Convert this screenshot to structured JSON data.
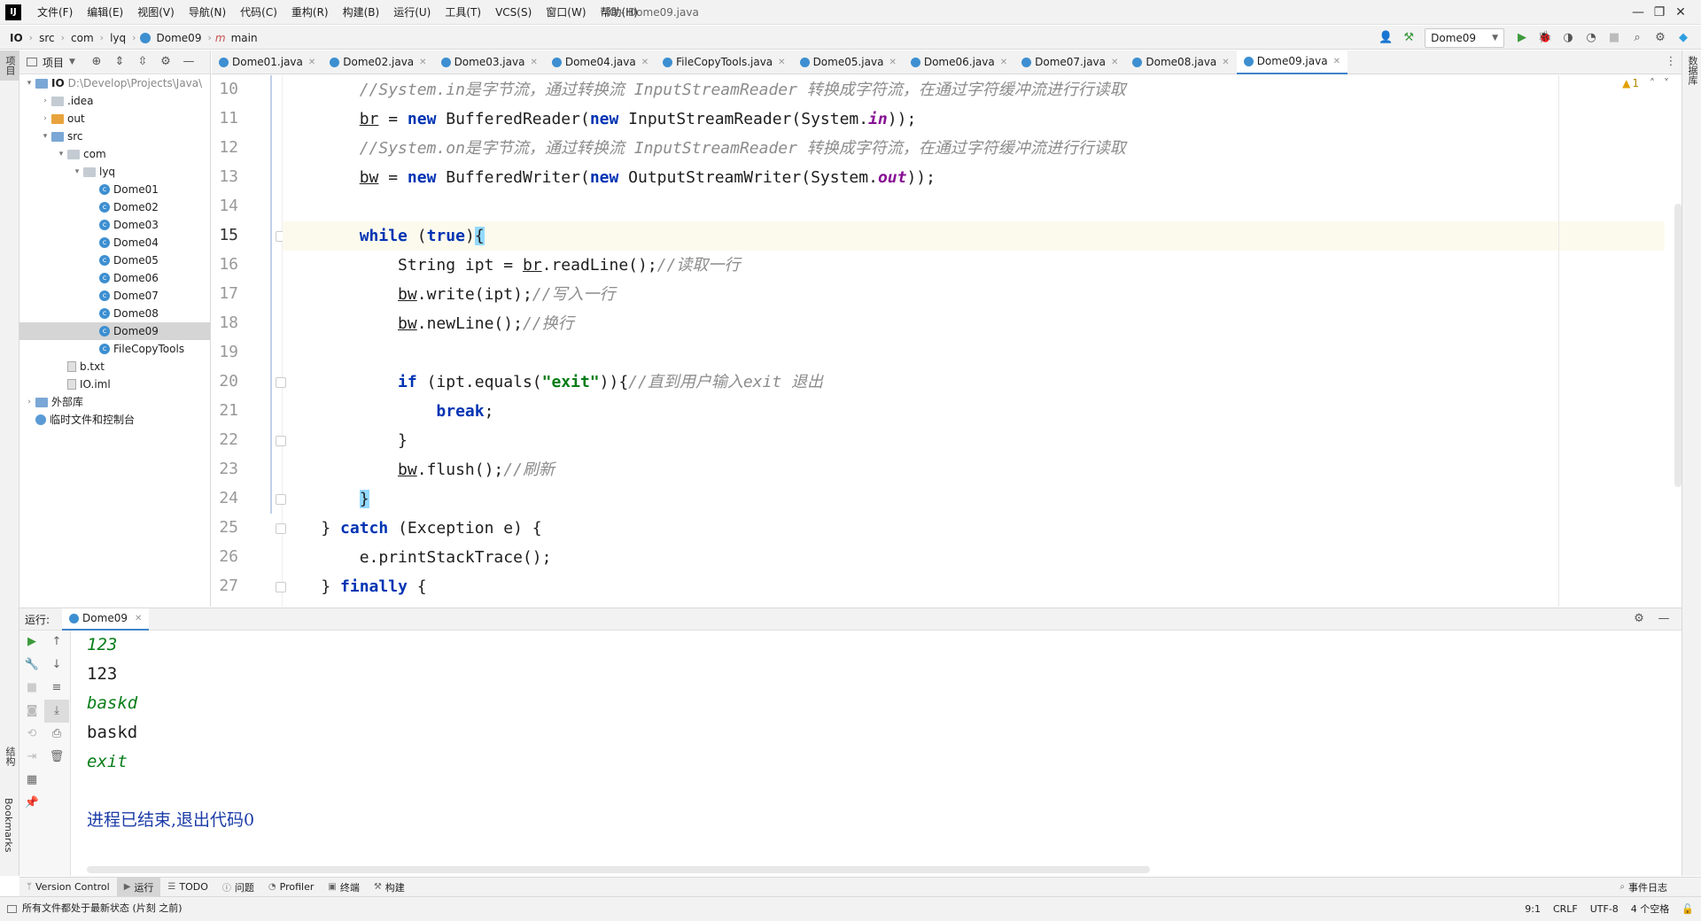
{
  "menubar": {
    "logo": "IJ",
    "items": [
      "文件(F)",
      "编辑(E)",
      "视图(V)",
      "导航(N)",
      "代码(C)",
      "重构(R)",
      "构建(B)",
      "运行(U)",
      "工具(T)",
      "VCS(S)",
      "窗口(W)",
      "帮助(H)"
    ],
    "title": "IO - Dome09.java",
    "controls": [
      "—",
      "❐",
      "✕"
    ]
  },
  "breadcrumb": {
    "items": [
      "IO",
      "src",
      "com",
      "lyq",
      "Dome09",
      "main"
    ]
  },
  "toolbar": {
    "run_config": "Dome09"
  },
  "left_stripe": {
    "project": "项目",
    "structure": "结构",
    "bookmarks": "Bookmarks"
  },
  "right_stripe": {
    "database": "数据库"
  },
  "project_panel": {
    "header": "项目",
    "tree": [
      {
        "label": "IO",
        "extra": "D:\\Develop\\Projects\\Java\\",
        "depth": 0,
        "arrow": "▾",
        "icon": "folder-blue"
      },
      {
        "label": ".idea",
        "depth": 1,
        "arrow": "›",
        "icon": "folder"
      },
      {
        "label": "out",
        "depth": 1,
        "arrow": "›",
        "icon": "folder-orange"
      },
      {
        "label": "src",
        "depth": 1,
        "arrow": "▾",
        "icon": "folder-blue"
      },
      {
        "label": "com",
        "depth": 2,
        "arrow": "▾",
        "icon": "folder"
      },
      {
        "label": "lyq",
        "depth": 3,
        "arrow": "▾",
        "icon": "folder"
      },
      {
        "label": "Dome01",
        "depth": 4,
        "arrow": "",
        "icon": "class"
      },
      {
        "label": "Dome02",
        "depth": 4,
        "arrow": "",
        "icon": "class"
      },
      {
        "label": "Dome03",
        "depth": 4,
        "arrow": "",
        "icon": "class"
      },
      {
        "label": "Dome04",
        "depth": 4,
        "arrow": "",
        "icon": "class"
      },
      {
        "label": "Dome05",
        "depth": 4,
        "arrow": "",
        "icon": "class"
      },
      {
        "label": "Dome06",
        "depth": 4,
        "arrow": "",
        "icon": "class"
      },
      {
        "label": "Dome07",
        "depth": 4,
        "arrow": "",
        "icon": "class"
      },
      {
        "label": "Dome08",
        "depth": 4,
        "arrow": "",
        "icon": "class"
      },
      {
        "label": "Dome09",
        "depth": 4,
        "arrow": "",
        "icon": "class",
        "selected": true
      },
      {
        "label": "FileCopyTools",
        "depth": 4,
        "arrow": "",
        "icon": "class"
      },
      {
        "label": "b.txt",
        "depth": 2,
        "arrow": "",
        "icon": "file"
      },
      {
        "label": "IO.iml",
        "depth": 2,
        "arrow": "",
        "icon": "file"
      },
      {
        "label": "外部库",
        "depth": 0,
        "arrow": "›",
        "icon": "library"
      },
      {
        "label": "临时文件和控制台",
        "depth": 0,
        "arrow": "",
        "icon": "scratch"
      }
    ]
  },
  "tabs": [
    "Dome01.java",
    "Dome02.java",
    "Dome03.java",
    "Dome04.java",
    "FileCopyTools.java",
    "Dome05.java",
    "Dome06.java",
    "Dome07.java",
    "Dome08.java",
    "Dome09.java"
  ],
  "active_tab": "Dome09.java",
  "editor": {
    "warning_count": "1",
    "line_numbers": [
      "10",
      "11",
      "12",
      "13",
      "14",
      "15",
      "16",
      "17",
      "18",
      "19",
      "20",
      "21",
      "22",
      "23",
      "24",
      "25",
      "26",
      "27"
    ],
    "current_line": "15",
    "code": {
      "l10_comment": "//System.in是字节流，通过转换流 InputStreamReader 转换成字符流，在通过字符缓冲流进行行读取",
      "l11_a": "br",
      "l11_b": " = ",
      "l11_new1": "new",
      "l11_c": " BufferedReader(",
      "l11_new2": "new",
      "l11_d": " InputStreamReader(System.",
      "l11_field": "in",
      "l11_e": "));",
      "l12_comment": "//System.on是字节流，通过转换流 InputStreamReader 转换成字符流，在通过字符缓冲流进行行读取",
      "l13_a": "bw",
      "l13_b": " = ",
      "l13_new1": "new",
      "l13_c": " BufferedWriter(",
      "l13_new2": "new",
      "l13_d": " OutputStreamWriter(System.",
      "l13_field": "out",
      "l13_e": "));",
      "l15_while": "while",
      "l15_b": " (",
      "l15_true": "true",
      "l15_c": ")",
      "l15_brace": "{",
      "l16_a": "String ipt = ",
      "l16_br": "br",
      "l16_b": ".readLine();",
      "l16_comment": "//读取一行",
      "l17_bw": "bw",
      "l17_a": ".write(ipt);",
      "l17_comment": "//写入一行",
      "l18_bw": "bw",
      "l18_a": ".newLine();",
      "l18_comment": "//换行",
      "l20_if": "if",
      "l20_a": " (ipt.equals(",
      "l20_str": "\"exit\"",
      "l20_b": ")){",
      "l20_comment": "//直到用户输入exit 退出",
      "l21_break": "break",
      "l21_a": ";",
      "l22": "}",
      "l23_bw": "bw",
      "l23_a": ".flush();",
      "l23_comment": "//刷新",
      "l24_brace": "}",
      "l25_a": "} ",
      "l25_catch": "catch",
      "l25_b": " (Exception e) {",
      "l26": "e.printStackTrace();",
      "l27_a": "} ",
      "l27_finally": "finally",
      "l27_b": " {"
    }
  },
  "run_panel": {
    "label": "运行:",
    "tab": "Dome09",
    "console": [
      {
        "text": "123",
        "kind": "input"
      },
      {
        "text": "123",
        "kind": "output"
      },
      {
        "text": "baskd",
        "kind": "input"
      },
      {
        "text": "baskd",
        "kind": "output"
      },
      {
        "text": "exit",
        "kind": "input"
      },
      {
        "text": "",
        "kind": "blank"
      },
      {
        "text": "进程已结束,退出代码0",
        "kind": "exit"
      }
    ]
  },
  "bottom_tools": [
    "Version Control",
    "运行",
    "TODO",
    "问题",
    "Profiler",
    "终端",
    "构建"
  ],
  "bottom_tools_active": "运行",
  "event_log": "事件日志",
  "statusbar": {
    "message": "所有文件都处于最新状态 (片刻 之前)",
    "position": "9:1",
    "line_sep": "CRLF",
    "encoding": "UTF-8",
    "indent": "4 个空格"
  }
}
